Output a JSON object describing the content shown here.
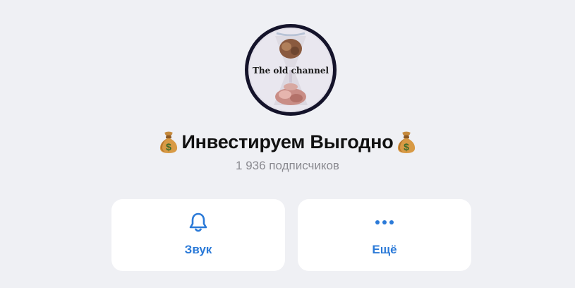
{
  "channel": {
    "avatar_caption": "The old channel",
    "title": "Инвестируем Выгодно",
    "title_icon": "money-bag-emoji",
    "subscribers": "1 936 подписчиков"
  },
  "actions": [
    {
      "label": "Звук",
      "icon": "bell-icon"
    },
    {
      "label": "Ещё",
      "icon": "more-dots-icon"
    }
  ],
  "colors": {
    "background": "#eff0f4",
    "accent": "#2b7ad8",
    "card": "#ffffff",
    "muted_text": "#8a8a90"
  }
}
